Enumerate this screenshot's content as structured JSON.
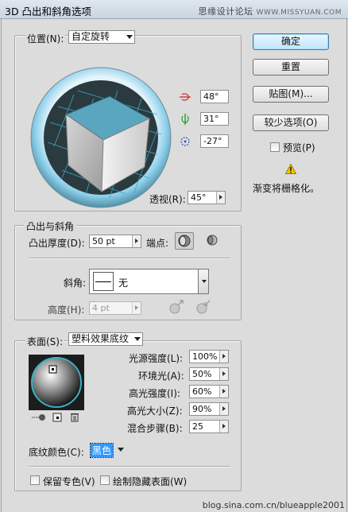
{
  "window": {
    "title": "3D 凸出和斜角选项",
    "watermark_top": "思缘设计论坛",
    "watermark_top_url": "WWW.MISSYUAN.COM"
  },
  "position": {
    "label": "位置(N):",
    "preset": "自定旋转",
    "x_rotation": "48°",
    "y_rotation": "31°",
    "z_rotation": "-27°",
    "perspective_label": "透视(R):",
    "perspective_value": "45°"
  },
  "buttons": {
    "ok": "确定",
    "reset": "重置",
    "map": "贴图(M)...",
    "fewer_options": "较少选项(O)"
  },
  "preview": {
    "label": "预览(P)",
    "warning": "渐变将栅格化。"
  },
  "extrude": {
    "group_label": "凸出与斜角",
    "depth_label": "凸出厚度(D):",
    "depth_value": "50 pt",
    "cap_label": "端点:",
    "bevel_label": "斜角:",
    "bevel_value": "无",
    "height_label": "高度(H):",
    "height_value": "4 pt"
  },
  "surface": {
    "label": "表面(S):",
    "value": "塑料效果底纹",
    "light_intensity_label": "光源强度(L):",
    "light_intensity": "100%",
    "ambient_label": "环境光(A):",
    "ambient": "50%",
    "highlight_intensity_label": "高光强度(I):",
    "highlight_intensity": "60%",
    "highlight_size_label": "高光大小(Z):",
    "highlight_size": "90%",
    "blend_steps_label": "混合步骤(B):",
    "blend_steps": "25",
    "shading_color_label": "底纹颜色(C):",
    "shading_color": "黑色",
    "preserve_spot_label": "保留专色(V)",
    "draw_hidden_label": "绘制隐藏表面(W)"
  },
  "footer": {
    "watermark": "blog.sina.com.cn/blueapple2001"
  },
  "colors": {
    "cube_top": "#5aa6bf",
    "accent_blue": "#3c7fb1",
    "ring": "#79c3e0"
  }
}
